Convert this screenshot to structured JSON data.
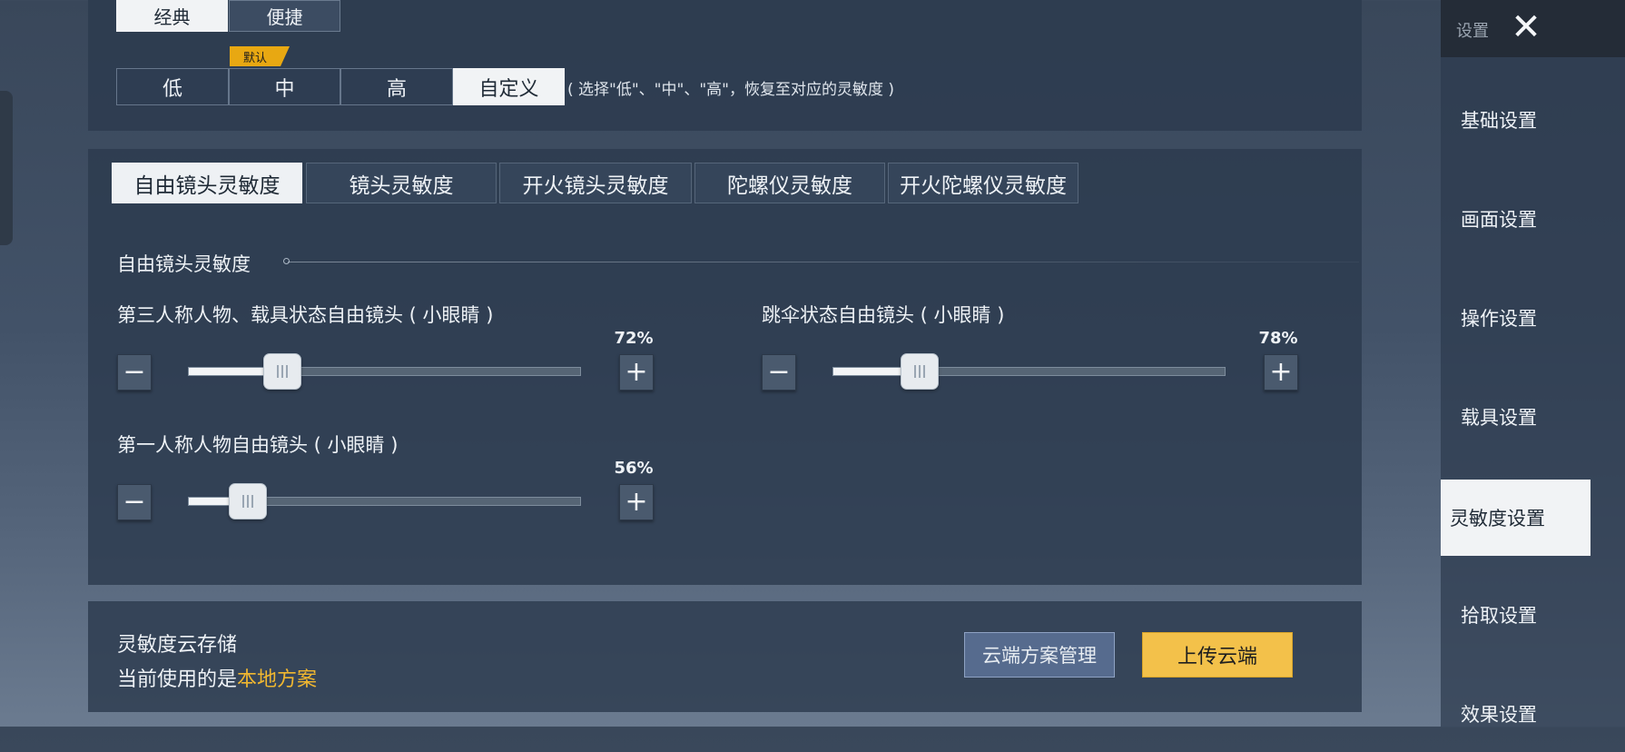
{
  "modes": {
    "classic": "经典",
    "quick": "便捷"
  },
  "presets": {
    "low": "低",
    "mid": "中",
    "high": "高",
    "custom": "自定义",
    "default_tag": "默认",
    "hint": "( 选择\"低\"、\"中\"、\"高\"，恢复至对应的灵敏度 )"
  },
  "tabs": [
    {
      "label": "自由镜头灵敏度",
      "active": true
    },
    {
      "label": "镜头灵敏度"
    },
    {
      "label": "开火镜头灵敏度"
    },
    {
      "label": "陀螺仪灵敏度"
    },
    {
      "label": "开火陀螺仪灵敏度"
    }
  ],
  "section": {
    "title": "自由镜头灵敏度"
  },
  "sliders": [
    {
      "label": "第三人称人物、载具状态自由镜头 ( 小眼睛 )",
      "percent_text": "72%",
      "fill_fraction": 0.24
    },
    {
      "label": "跳伞状态自由镜头 ( 小眼睛 )",
      "percent_text": "78%",
      "fill_fraction": 0.22
    },
    {
      "label": "第一人称人物自由镜头 ( 小眼睛 )",
      "percent_text": "56%",
      "fill_fraction": 0.15
    }
  ],
  "cloud": {
    "title": "灵敏度云存储",
    "status_prefix": "当前使用的是",
    "status_value": "本地方案",
    "manage": "云端方案管理",
    "upload": "上传云端"
  },
  "sidebar": {
    "title": "设置",
    "close_icon": "close-icon",
    "items": [
      "基础设置",
      "画面设置",
      "操作设置",
      "载具设置",
      "灵敏度设置",
      "拾取设置",
      "效果设置"
    ],
    "active_index": 4
  },
  "colors": {
    "accent": "#f3c14a",
    "highlight_text": "#f0b730",
    "panel": "#2c3a4e"
  }
}
